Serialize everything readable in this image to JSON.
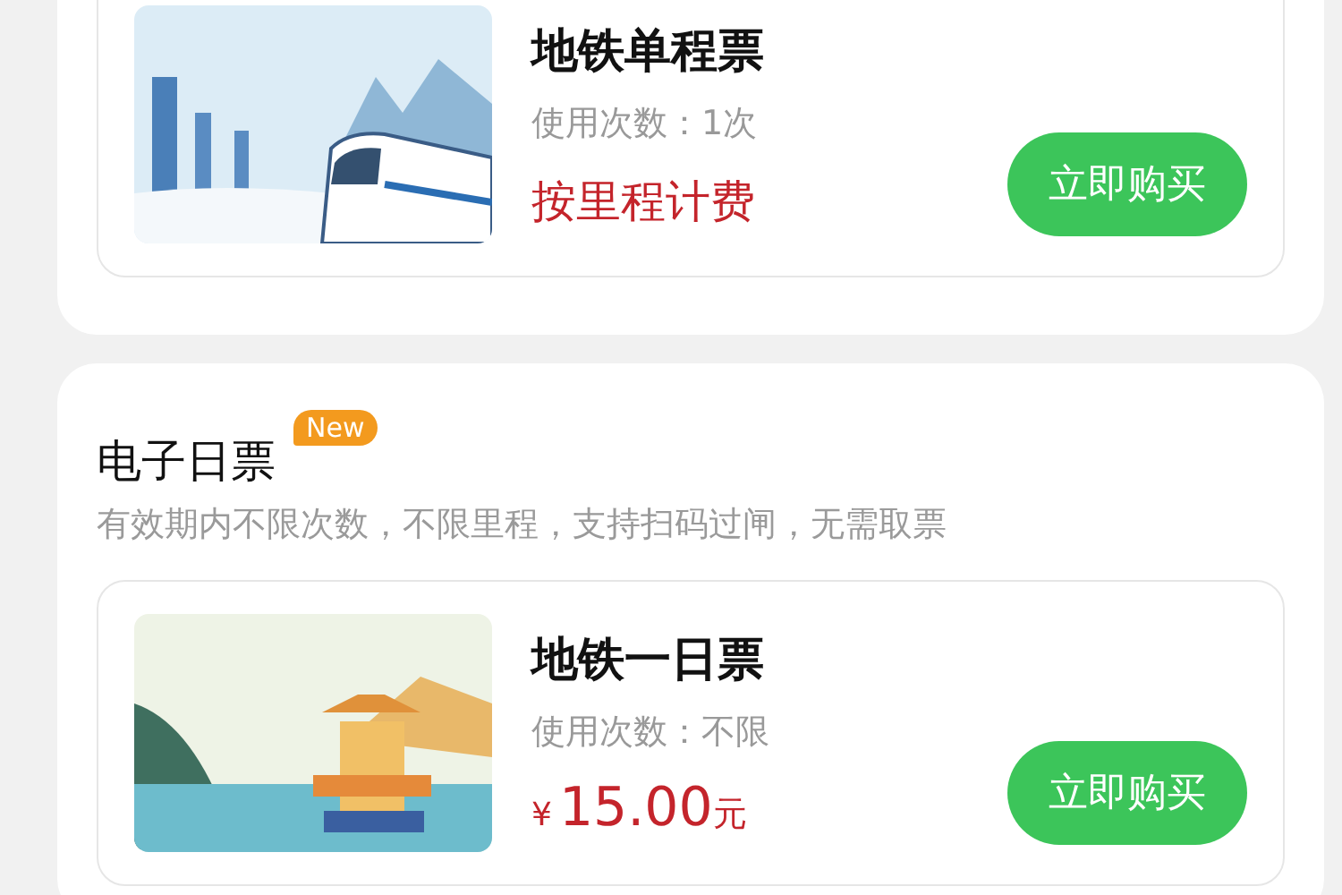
{
  "sections": [
    {
      "tickets": [
        {
          "title": "地铁单程票",
          "usage": "使用次数：1次",
          "price": {
            "kind": "text",
            "text": "按里程计费"
          },
          "button": "立即购买",
          "kind": "city"
        }
      ]
    },
    {
      "title": "电子日票",
      "badge": "New",
      "description": "有效期内不限次数，不限里程，支持扫码过闸，无需取票",
      "tickets": [
        {
          "title": "地铁一日票",
          "usage": "使用次数：不限",
          "price": {
            "kind": "amount",
            "currency": "¥",
            "amount": "15.00",
            "unit": "元"
          },
          "button": "立即购买",
          "kind": "pavilion"
        }
      ]
    }
  ]
}
